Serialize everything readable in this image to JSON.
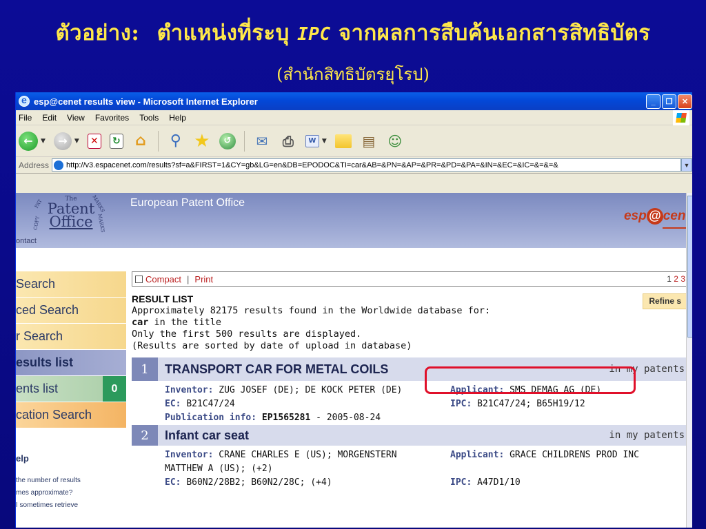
{
  "slide": {
    "title_prefix": "ตัวอย่าง:",
    "title_main": "ตำแหน่งที่ระบุ",
    "title_ipc": "IPC",
    "title_suffix": "จากผลการสืบค้นเอกสารสิทธิบัตร",
    "subtitle": "(สำนักสิทธิบัตรยุโรป)"
  },
  "window": {
    "title": "esp@cenet results view - Microsoft Internet Explorer",
    "menu": [
      "File",
      "Edit",
      "View",
      "Favorites",
      "Tools",
      "Help"
    ],
    "address_label": "Address",
    "url": "http://v3.espacenet.com/results?sf=a&FIRST=1&CY=gb&LG=en&DB=EPODOC&TI=car&AB=&PN=&AP=&PR=&PD=&PA=&IN=&EC=&IC=&=&=&"
  },
  "site": {
    "crest_top": "The",
    "crest_line1": "Patent",
    "crest_line2": "Office",
    "crest_corner_l": "PAT",
    "crest_corner_r": "MARKS",
    "crest_corner_bl": "COPY",
    "crest_corner_br": "MARKS",
    "contact": "ontact",
    "org_name": "European Patent Office",
    "logo_pre": "esp",
    "logo_at": "@",
    "logo_post": "cene"
  },
  "nav": {
    "items": [
      {
        "label": "Search"
      },
      {
        "label": "ced Search"
      },
      {
        "label": "r Search"
      },
      {
        "label": "esults list"
      },
      {
        "label": "ents list",
        "count": "0"
      },
      {
        "label": "cation Search"
      }
    ],
    "help_title": "elp",
    "help_links": [
      "the number of results",
      "mes approximate?",
      "I sometimes retrieve"
    ]
  },
  "toolbar": {
    "compact": "Compact",
    "separator": "|",
    "print": "Print",
    "page1": "1",
    "page2": "2",
    "page3": "3"
  },
  "summary": {
    "heading": "RESULT LIST",
    "line1": "Approximately 82175 results found in the Worldwide database for:",
    "term": "car",
    "line2_rest": " in the title",
    "line3": "Only the first 500 results are displayed.",
    "line4": "(Results are sorted by date of upload in database)",
    "refine": "Refine s"
  },
  "results": [
    {
      "num": "1",
      "title": "TRANSPORT CAR FOR METAL COILS",
      "mine": "in my patents",
      "inventor_label": "Inventor:",
      "inventor": "ZUG JOSEF (DE); DE KOCK PETER (DE)",
      "applicant_label": "Applicant:",
      "applicant": "SMS DEMAG AG (DE)",
      "ec_label": "EC:",
      "ec": "B21C47/24",
      "ipc_label": "IPC:",
      "ipc": "B21C47/24; B65H19/12",
      "pub_label": "Publication info:",
      "pub_num": "EP1565281",
      "pub_date": "- 2005-08-24"
    },
    {
      "num": "2",
      "title": "Infant car seat",
      "mine": "in my patents",
      "inventor_label": "Inventor:",
      "inventor": "CRANE CHARLES E (US); MORGENSTERN",
      "inventor_cont": "MATTHEW A (US); (+2)",
      "applicant_label": "Applicant:",
      "applicant": "GRACE CHILDRENS PROD INC",
      "ec_label": "EC:",
      "ec": "B60N2/28B2; B60N2/28C; (+4)",
      "ipc_label": "IPC:",
      "ipc": "A47D1/10"
    }
  ],
  "colors": {
    "slide_bg": "#0a0a8c",
    "slide_title": "#ffe84a",
    "highlight": "#e0102a"
  }
}
